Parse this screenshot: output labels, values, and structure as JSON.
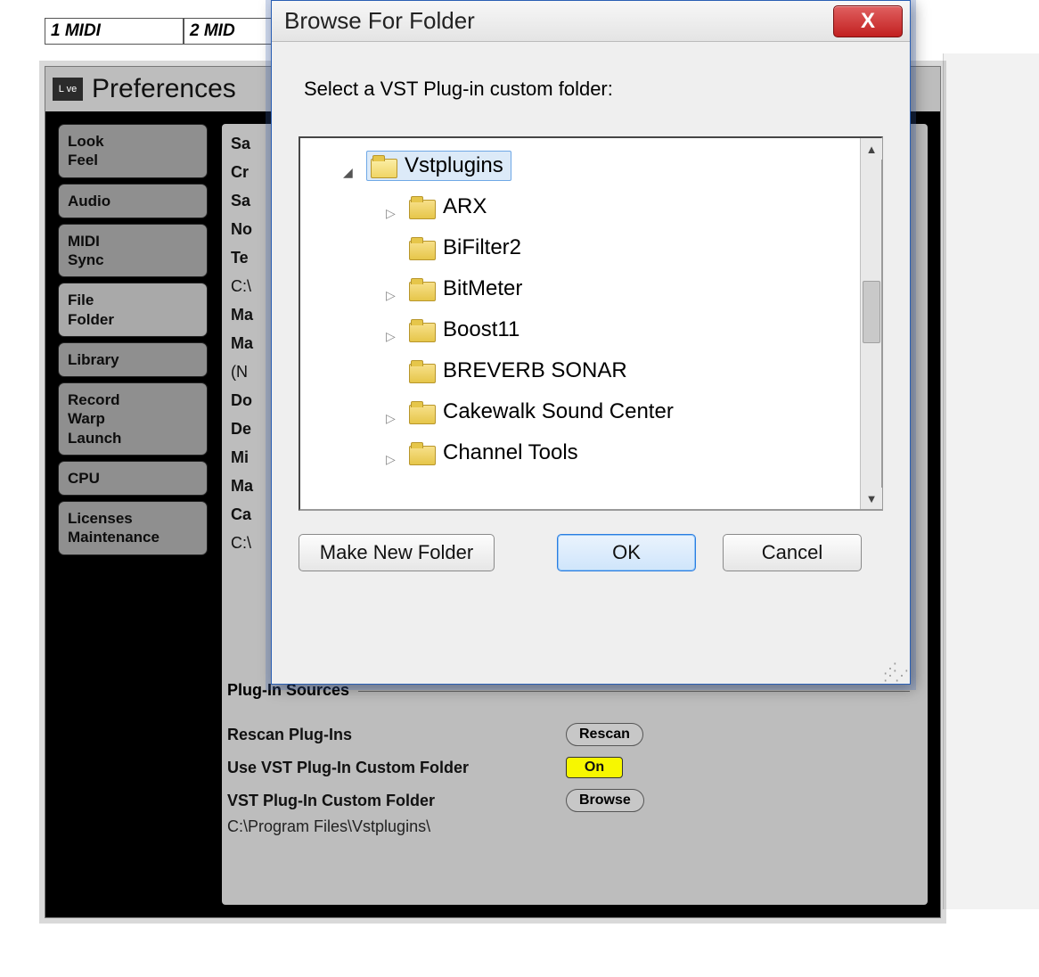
{
  "tabstrip": {
    "tabs": [
      "1 MIDI",
      "2 MID"
    ]
  },
  "prefs": {
    "logo_text": "L ve",
    "title": "Preferences",
    "sidebar": [
      "Look\nFeel",
      "Audio",
      "MIDI\nSync",
      "File\nFolder",
      "Library",
      "Record\nWarp\nLaunch",
      "CPU",
      "Licenses\nMaintenance"
    ],
    "active_sidebar_index": 3,
    "main": {
      "partial_left_labels": [
        "Sa",
        "Cr",
        "Sa",
        "No",
        "Te",
        "C:\\",
        "Ma",
        "Ma",
        "(N",
        "Do",
        "De",
        "Mi",
        "Ma",
        "Ca",
        "C:\\"
      ],
      "section_title": "Plug-In Sources",
      "rescan_label": "Rescan Plug-Ins",
      "rescan_button": "Rescan",
      "use_vst_label": "Use VST Plug-In Custom Folder",
      "use_vst_value": "On",
      "custom_folder_label": "VST Plug-In Custom Folder",
      "browse_button": "Browse",
      "custom_folder_path": "C:\\Program Files\\Vstplugins\\"
    }
  },
  "dialog": {
    "title": "Browse For Folder",
    "prompt": "Select a VST Plug-in custom folder:",
    "close_glyph": "X",
    "tree": {
      "root": "Vstplugins",
      "items": [
        {
          "name": "ARX",
          "expandable": true
        },
        {
          "name": "BiFilter2",
          "expandable": false
        },
        {
          "name": "BitMeter",
          "expandable": true
        },
        {
          "name": "Boost11",
          "expandable": true
        },
        {
          "name": "BREVERB SONAR",
          "expandable": false
        },
        {
          "name": "Cakewalk Sound Center",
          "expandable": true
        },
        {
          "name": "Channel Tools",
          "expandable": true
        }
      ]
    },
    "buttons": {
      "make_new": "Make New Folder",
      "ok": "OK",
      "cancel": "Cancel"
    }
  }
}
